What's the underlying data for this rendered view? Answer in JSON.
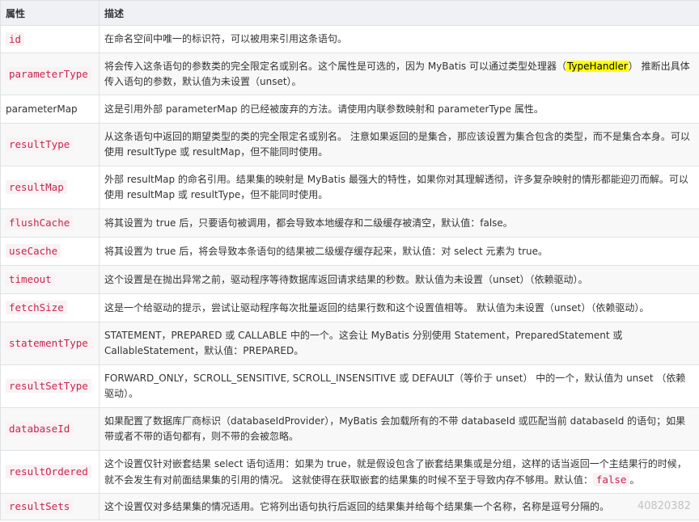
{
  "header": {
    "col1": "属性",
    "col2": "描述"
  },
  "rows": [
    {
      "name": "id",
      "desc": "在命名空间中唯一的标识符，可以被用来引用这条语句。"
    },
    {
      "name": "parameterType",
      "desc_pre": "将会传入这条语句的参数类的完全限定名或别名。这个属性是可选的，因为 MyBatis 可以通过类型处理器（",
      "desc_hl": "TypeHandler",
      "desc_post": "） 推断出具体传入语句的参数，默认值为未设置（unset）。"
    },
    {
      "name": "parameterMap",
      "desc": "这是引用外部 parameterMap 的已经被废弃的方法。请使用内联参数映射和 parameterType 属性。"
    },
    {
      "name": "resultType",
      "desc": "从这条语句中返回的期望类型的类的完全限定名或别名。 注意如果返回的是集合，那应该设置为集合包含的类型，而不是集合本身。可以使用 resultType 或 resultMap，但不能同时使用。"
    },
    {
      "name": "resultMap",
      "desc": "外部 resultMap 的命名引用。结果集的映射是 MyBatis 最强大的特性，如果你对其理解透彻，许多复杂映射的情形都能迎刃而解。可以使用 resultMap 或 resultType，但不能同时使用。"
    },
    {
      "name": "flushCache",
      "desc": "将其设置为 true 后，只要语句被调用，都会导致本地缓存和二级缓存被清空，默认值：false。"
    },
    {
      "name": "useCache",
      "desc": "将其设置为 true 后，将会导致本条语句的结果被二级缓存缓存起来，默认值：对 select 元素为 true。"
    },
    {
      "name": "timeout",
      "desc": "这个设置是在抛出异常之前，驱动程序等待数据库返回请求结果的秒数。默认值为未设置（unset）（依赖驱动）。"
    },
    {
      "name": "fetchSize",
      "desc": "这是一个给驱动的提示，尝试让驱动程序每次批量返回的结果行数和这个设置值相等。 默认值为未设置（unset）（依赖驱动）。"
    },
    {
      "name": "statementType",
      "desc": "STATEMENT，PREPARED 或 CALLABLE 中的一个。这会让 MyBatis 分别使用 Statement，PreparedStatement 或 CallableStatement，默认值：PREPARED。"
    },
    {
      "name": "resultSetType",
      "desc": "FORWARD_ONLY，SCROLL_SENSITIVE, SCROLL_INSENSITIVE 或 DEFAULT（等价于 unset） 中的一个，默认值为 unset （依赖驱动）。"
    },
    {
      "name": "databaseId",
      "desc": "如果配置了数据库厂商标识（databaseIdProvider），MyBatis 会加载所有的不带 databaseId 或匹配当前 databaseId 的语句；如果带或者不带的语句都有，则不带的会被忽略。"
    },
    {
      "name": "resultOrdered",
      "desc_pre": "这个设置仅针对嵌套结果 select 语句适用：如果为 true，就是假设包含了嵌套结果集或是分组，这样的话当返回一个主结果行的时候，就不会发生有对前面结果集的引用的情况。 这就使得在获取嵌套的结果集的时候不至于导致内存不够用。默认值：",
      "desc_code": "false",
      "desc_post": "。"
    },
    {
      "name": "resultSets",
      "desc": "这个设置仅对多结果集的情况适用。它将列出语句执行后返回的结果集并给每个结果集一个名称，名称是逗号分隔的。"
    }
  ],
  "watermark": "40820382"
}
